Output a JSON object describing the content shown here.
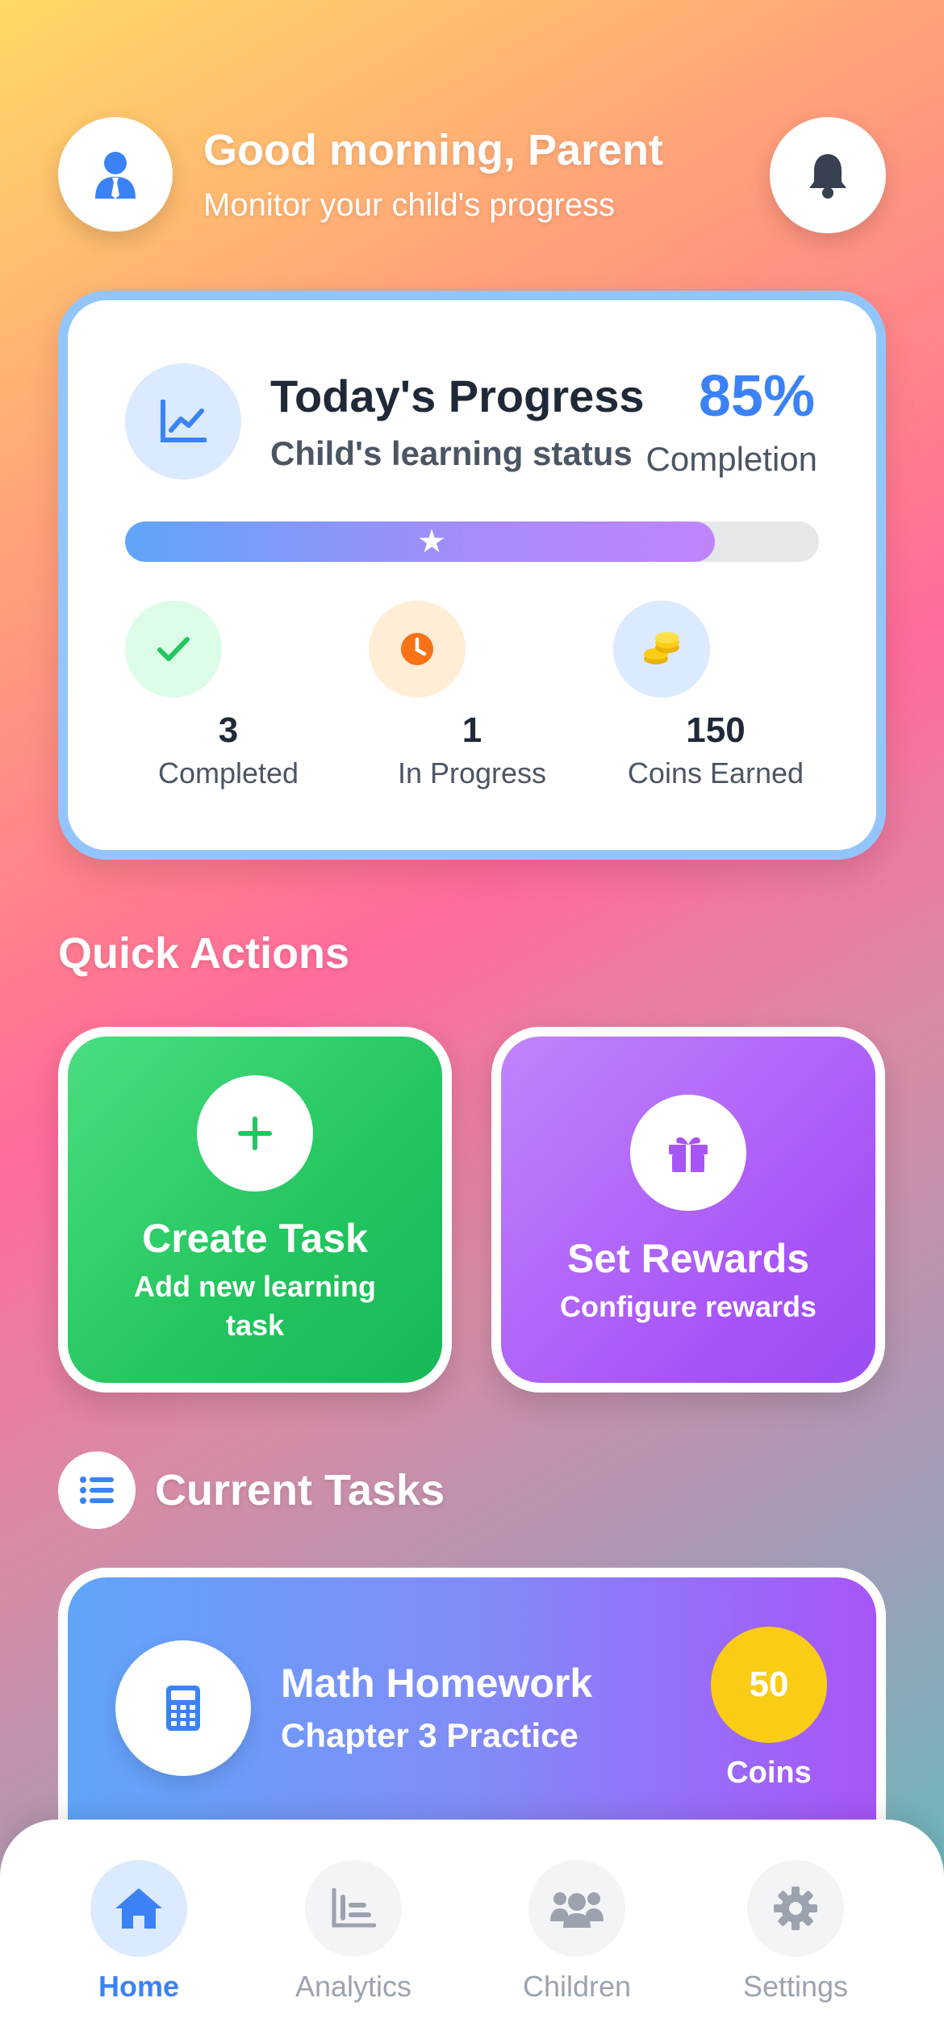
{
  "header": {
    "greeting": "Good morning, Parent",
    "subtitle": "Monitor your child's progress",
    "avatar_icon": "user-tie-icon",
    "notification_icon": "bell-icon"
  },
  "progress_card": {
    "title": "Today's Progress",
    "subtitle": "Child's learning status",
    "percent_text": "85%",
    "percent_label": "Completion",
    "progress_fraction": 0.85,
    "icon": "chart-line-icon",
    "stats": [
      {
        "value": "3",
        "label": "Completed",
        "icon": "check-icon",
        "color": "#22c55e"
      },
      {
        "value": "1",
        "label": "In Progress",
        "icon": "clock-icon",
        "color": "#f97316"
      },
      {
        "value": "150",
        "label": "Coins Earned",
        "icon": "coins-icon",
        "color": "#eab308"
      }
    ]
  },
  "quick_actions": {
    "title": "Quick Actions",
    "items": [
      {
        "title": "Create Task",
        "subtitle": "Add new learning task",
        "icon": "plus-icon",
        "color": "#22c55e"
      },
      {
        "title": "Set Rewards",
        "subtitle": "Configure rewards",
        "icon": "gift-icon",
        "color": "#a855f7"
      }
    ]
  },
  "current_tasks": {
    "title": "Current Tasks",
    "icon": "list-icon",
    "items": [
      {
        "title": "Math Homework",
        "subtitle": "Chapter 3 Practice",
        "coins": "50",
        "coins_label": "Coins",
        "icon": "calculator-icon"
      }
    ]
  },
  "nav": {
    "items": [
      {
        "label": "Home",
        "icon": "home-icon",
        "active": true
      },
      {
        "label": "Analytics",
        "icon": "analytics-icon",
        "active": false
      },
      {
        "label": "Children",
        "icon": "users-icon",
        "active": false
      },
      {
        "label": "Settings",
        "icon": "gear-icon",
        "active": false
      }
    ]
  },
  "colors": {
    "accent": "#3b82f6",
    "inactive": "#9ca3af"
  }
}
